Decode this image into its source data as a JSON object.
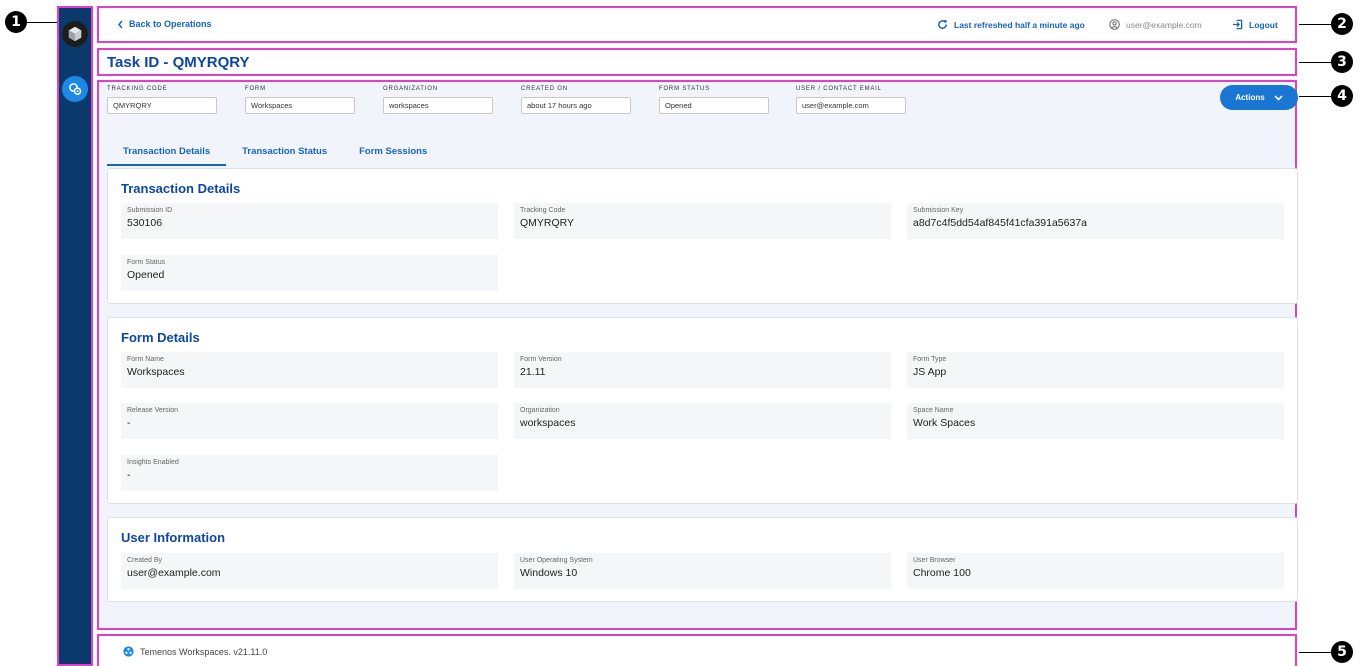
{
  "markers": [
    "1",
    "2",
    "3",
    "4",
    "5"
  ],
  "header": {
    "back_label": "Back to Operations",
    "refresh_label": "Last refreshed half a minute ago",
    "user_email": "user@example.com",
    "logout_label": "Logout"
  },
  "page_title": "Task ID - QMYRQRY",
  "meta": [
    {
      "label": "TRACKING CODE",
      "value": "QMYRQRY"
    },
    {
      "label": "FORM",
      "value": "Workspaces"
    },
    {
      "label": "ORGANIZATION",
      "value": "workspaces"
    },
    {
      "label": "CREATED ON",
      "value": "about 17 hours ago"
    },
    {
      "label": "FORM STATUS",
      "value": "Opened"
    },
    {
      "label": "USER / CONTACT EMAIL",
      "value": "user@example.com"
    }
  ],
  "actions_label": "Actions",
  "tabs": [
    {
      "label": "Transaction Details",
      "active": true
    },
    {
      "label": "Transaction Status",
      "active": false
    },
    {
      "label": "Form Sessions",
      "active": false
    }
  ],
  "sections": {
    "transaction": {
      "title": "Transaction Details",
      "fields": [
        {
          "label": "Submission ID",
          "value": "530106"
        },
        {
          "label": "Tracking Code",
          "value": "QMYRQRY"
        },
        {
          "label": "Submission Key",
          "value": "a8d7c4f5dd54af845f41cfa391a5637a"
        },
        {
          "label": "Form Status",
          "value": "Opened"
        }
      ]
    },
    "form": {
      "title": "Form Details",
      "fields": [
        {
          "label": "Form Name",
          "value": "Workspaces"
        },
        {
          "label": "Form Version",
          "value": "21.11"
        },
        {
          "label": "Form Type",
          "value": "JS App"
        },
        {
          "label": "Release Version",
          "value": "-"
        },
        {
          "label": "Organization",
          "value": "workspaces"
        },
        {
          "label": "Space Name",
          "value": "Work Spaces"
        },
        {
          "label": "Insights Enabled",
          "value": "-"
        }
      ]
    },
    "user": {
      "title": "User Information",
      "fields": [
        {
          "label": "Created By",
          "value": "user@example.com"
        },
        {
          "label": "User Operating System",
          "value": "Windows 10"
        },
        {
          "label": "User Browser",
          "value": "Chrome 100"
        }
      ]
    }
  },
  "footer": {
    "text": "Temenos Workspaces. v21.11.0"
  },
  "icons": {
    "logo": "cube-logo-icon",
    "nav": "operations-icon",
    "back": "chevron-left-icon",
    "refresh": "refresh-icon",
    "user": "user-circle-icon",
    "logout": "logout-icon",
    "actions": "chevron-down-icon",
    "footer": "temenos-logo-icon"
  },
  "colors": {
    "accent": "#1565c0",
    "sidebar": "#0a3a6b",
    "annotation": "#e040c8"
  }
}
